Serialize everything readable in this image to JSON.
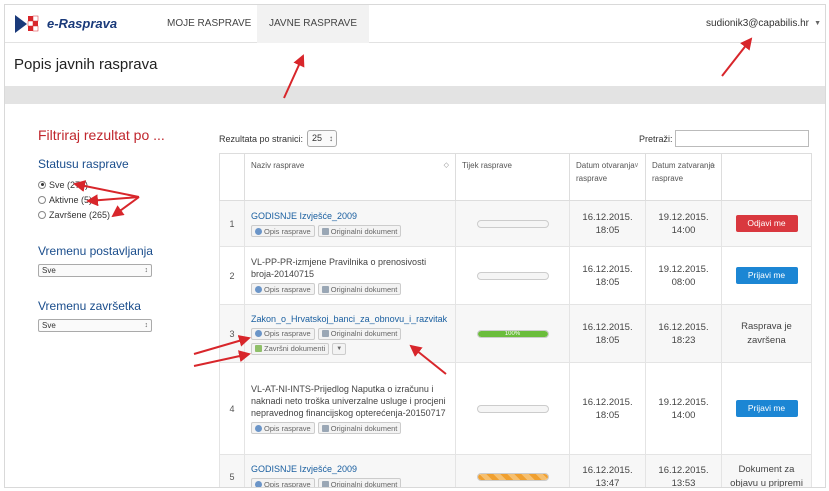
{
  "app": {
    "name": "e-Rasprava"
  },
  "nav": {
    "tabs": [
      {
        "label": "MOJE RASPRAVE"
      },
      {
        "label": "JAVNE RASPRAVE"
      }
    ]
  },
  "user": {
    "email": "sudionik3@capabilis.hr"
  },
  "page": {
    "title": "Popis javnih rasprava"
  },
  "sidebar": {
    "filter_title": "Filtriraj rezultat po ...",
    "status_title": "Statusu rasprave",
    "status_options": [
      {
        "label": "Sve (270)",
        "selected": true
      },
      {
        "label": "Aktivne (5)",
        "selected": false
      },
      {
        "label": "Završene (265)",
        "selected": false
      }
    ],
    "posted_title": "Vremenu postavljanja",
    "posted_value": "Sve",
    "end_title": "Vremenu završetka",
    "end_value": "Sve"
  },
  "controls": {
    "perpage_label": "Rezultata po stranici:",
    "perpage_value": "25",
    "search_label": "Pretraži:"
  },
  "table": {
    "headers": [
      "Naziv rasprave",
      "Tijek rasprave",
      "Datum otvaranja rasprave",
      "Datum zatvaranja rasprave"
    ],
    "chip_labels": {
      "opis": "Opis rasprave",
      "orig": "Originalni dokument",
      "final": "Završni dokumenti"
    },
    "rows": [
      {
        "num": "1",
        "title": "GODISNJE Izvješće_2009",
        "link": true,
        "progress": 0.0,
        "progress_text": "",
        "open_date": "16.12.2015.",
        "open_time": "18:05",
        "close_date": "19.12.2015.",
        "close_time": "14:00",
        "action": "Odjavi me",
        "action_color": "#d9383f",
        "status": ""
      },
      {
        "num": "2",
        "title": "VL-PP-PR-izmjene Pravilnika o prenosivosti broja-20140715",
        "link": false,
        "progress": 0.0,
        "progress_text": "",
        "open_date": "16.12.2015.",
        "open_time": "18:05",
        "close_date": "19.12.2015.",
        "close_time": "08:00",
        "action": "Prijavi me",
        "action_color": "#1c86d4",
        "status": ""
      },
      {
        "num": "3",
        "title": "Zakon_o_Hrvatskoj_banci_za_obnovu_i_razvitak",
        "link": true,
        "progress": 1.0,
        "progress_text": "100%",
        "open_date": "16.12.2015.",
        "open_time": "18:05",
        "close_date": "16.12.2015.",
        "close_time": "18:23",
        "action": "",
        "action_color": "",
        "status": "Rasprava je završena"
      },
      {
        "num": "4",
        "title": "VL-AT-NI-INTS-Prijedlog Naputka o izračunu i naknadi neto troška univerzalne usluge i procjeni nepravednog financijskog opterećenja-20150717",
        "link": false,
        "progress": 0.0,
        "progress_text": "",
        "open_date": "16.12.2015.",
        "open_time": "18:05",
        "close_date": "19.12.2015.",
        "close_time": "14:00",
        "action": "Prijavi me",
        "action_color": "#1c86d4",
        "status": ""
      },
      {
        "num": "5",
        "title": "GODISNJE Izvješće_2009",
        "link": true,
        "progress": 1.0,
        "progress_text": "",
        "open_date": "16.12.2015.",
        "open_time": "13:47",
        "close_date": "16.12.2015.",
        "close_time": "13:53",
        "action": "",
        "action_color": "",
        "status": "Dokument za objavu u pripremi"
      }
    ]
  },
  "colors": {
    "accent_red": "#c0262d",
    "link_blue": "#1a5fa0",
    "btn_blue": "#1c86d4",
    "btn_red": "#d9383f",
    "arrow_red": "#d8262b"
  }
}
